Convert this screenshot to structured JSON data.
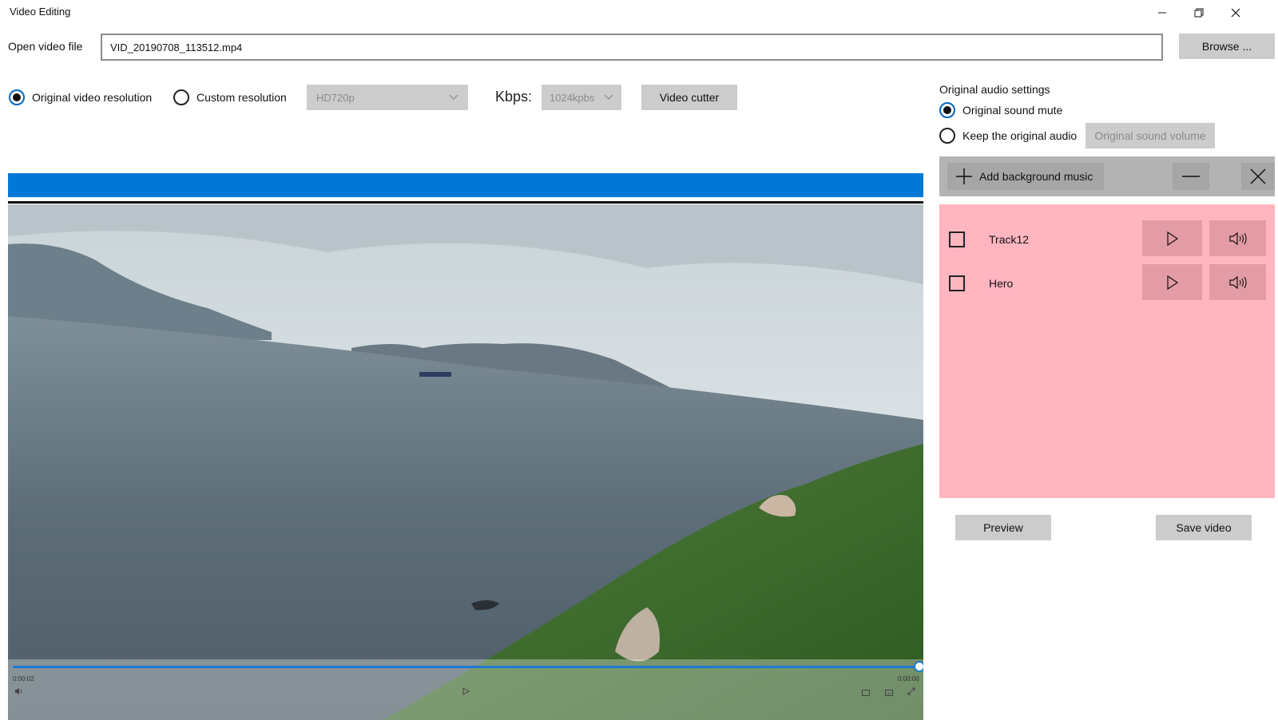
{
  "window": {
    "title": "Video Editing",
    "controls": [
      "minimize-icon",
      "restore-icon",
      "close-icon"
    ]
  },
  "file": {
    "label": "Open video file",
    "value": "VID_20190708_113512.mp4",
    "browse_label": "Browse ..."
  },
  "resolution": {
    "original_label": "Original video resolution",
    "original_selected": true,
    "custom_label": "Custom resolution",
    "custom_selected": false,
    "preset_value": "HD720p",
    "kbps_label": "Kbps:",
    "kbps_value": "1024kpbs",
    "cutter_label": "Video cutter"
  },
  "audio": {
    "heading": "Original audio settings",
    "mute_label": "Original sound mute",
    "mute_selected": true,
    "keep_label": "Keep the original audio",
    "keep_selected": false,
    "volume_label": "Original sound volume",
    "add_music_label": "Add background music",
    "tracks": [
      {
        "name": "Track12",
        "checked": false
      },
      {
        "name": "Hero",
        "checked": false
      }
    ]
  },
  "actions": {
    "preview_label": "Preview",
    "save_label": "Save video"
  },
  "player": {
    "current_time": "0:00:02",
    "total_time": "0:00:00",
    "progress": 1.0
  },
  "colors": {
    "accent": "#0078d7",
    "track_panel": "#ffb6c1",
    "button": "#cccccc",
    "toolbar": "#b3b3b3"
  }
}
